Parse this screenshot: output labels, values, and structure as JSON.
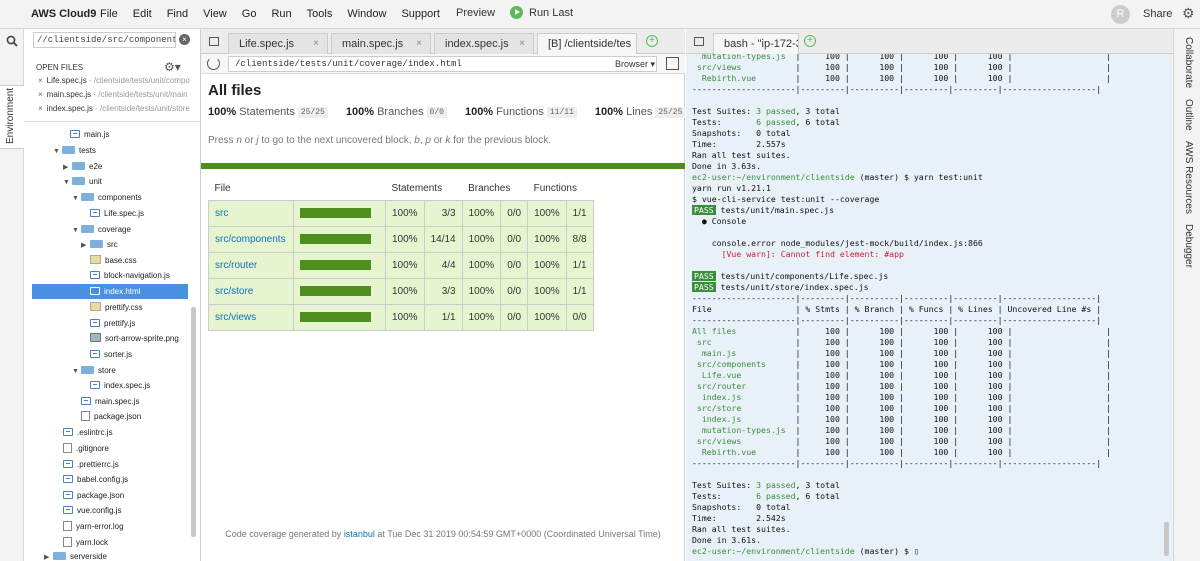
{
  "app": {
    "title": "AWS Cloud9",
    "menus": [
      "File",
      "Edit",
      "Find",
      "View",
      "Go",
      "Run",
      "Tools",
      "Window",
      "Support"
    ],
    "preview": "Preview",
    "run_last": "Run Last",
    "user_initial": "R",
    "share": "Share"
  },
  "left_rail": {
    "tab": "Environment"
  },
  "sidebar": {
    "path": "//clientside/src/components",
    "open_files_header": "OPEN FILES",
    "open_files": [
      {
        "name": "Life.spec.js",
        "path": " - /clientside/tests/unit/compo"
      },
      {
        "name": "main.spec.js",
        "path": " - /clientside/tests/unit/main"
      },
      {
        "name": "index.spec.js",
        "path": " - /clientside/tests/unit/store"
      }
    ],
    "tree": [
      {
        "label": "main.js"
      },
      {
        "label": "tests"
      },
      {
        "label": "e2e"
      },
      {
        "label": "unit"
      },
      {
        "label": "components"
      },
      {
        "label": "Life.spec.js"
      },
      {
        "label": "coverage"
      },
      {
        "label": "src"
      },
      {
        "label": "base.css"
      },
      {
        "label": "block-navigation.js"
      },
      {
        "label": "index.html"
      },
      {
        "label": "prettify.css"
      },
      {
        "label": "prettify.js"
      },
      {
        "label": "sort-arrow-sprite.png"
      },
      {
        "label": "sorter.js"
      },
      {
        "label": "store"
      },
      {
        "label": "index.spec.js"
      },
      {
        "label": "main.spec.js"
      },
      {
        "label": "package.json"
      },
      {
        "label": ".eslintrc.js"
      },
      {
        "label": ".gitignore"
      },
      {
        "label": ".prettierrc.js"
      },
      {
        "label": "babel.config.js"
      },
      {
        "label": "package.json"
      },
      {
        "label": "vue.config.js"
      },
      {
        "label": "yarn-error.log"
      },
      {
        "label": "yarn.lock"
      },
      {
        "label": "serverside"
      }
    ]
  },
  "editor_tabs": [
    "Life.spec.js",
    "main.spec.js",
    "index.spec.js",
    "[B] /clientside/tes"
  ],
  "browser": {
    "url": "/clientside/tests/unit/coverage/index.html",
    "mode": "Browser",
    "heading": "All files",
    "summary": [
      {
        "pct": "100%",
        "label": "Statements",
        "frac": "25/25"
      },
      {
        "pct": "100%",
        "label": "Branches",
        "frac": "0/0"
      },
      {
        "pct": "100%",
        "label": "Functions",
        "frac": "11/11"
      },
      {
        "pct": "100%",
        "label": "Lines",
        "frac": "25/25"
      }
    ],
    "hint_a": "Press ",
    "hint_n": "n",
    "hint_b": " or ",
    "hint_j": "j",
    "hint_c": " to go to the next uncovered block, ",
    "hint_bk": "b",
    "hint_d": ", ",
    "hint_p": "p",
    "hint_e": " or ",
    "hint_k": "k",
    "hint_f": " for the previous block.",
    "columns": [
      "File",
      "Statements",
      "Branches",
      "Functions"
    ],
    "rows": [
      {
        "file": "src",
        "stmt_pct": "100%",
        "stmt": "3/3",
        "br_pct": "100%",
        "br": "0/0",
        "fn_pct": "100%",
        "fn": "1/1",
        "bar": 1.0
      },
      {
        "file": "src/components",
        "stmt_pct": "100%",
        "stmt": "14/14",
        "br_pct": "100%",
        "br": "0/0",
        "fn_pct": "100%",
        "fn": "8/8",
        "bar": 1.0
      },
      {
        "file": "src/router",
        "stmt_pct": "100%",
        "stmt": "4/4",
        "br_pct": "100%",
        "br": "0/0",
        "fn_pct": "100%",
        "fn": "1/1",
        "bar": 1.0
      },
      {
        "file": "src/store",
        "stmt_pct": "100%",
        "stmt": "3/3",
        "br_pct": "100%",
        "br": "0/0",
        "fn_pct": "100%",
        "fn": "1/1",
        "bar": 1.0
      },
      {
        "file": "src/views",
        "stmt_pct": "100%",
        "stmt": "1/1",
        "br_pct": "100%",
        "br": "0/0",
        "fn_pct": "100%",
        "fn": "0/0",
        "bar": 1.0
      }
    ],
    "footer_a": "Code coverage generated by ",
    "footer_link": "istanbul",
    "footer_b": " at Tue Dec 31 2019 00:54:59 GMT+0000 (Coordinated Universal Time)"
  },
  "terminal": {
    "tab": "bash - \"ip-172-31",
    "lines": [
      [
        {
          "t": "  mutation-types.js  ",
          "c": "gr"
        },
        {
          "t": "|     100 |      100 |      100 |      100 |                   |"
        }
      ],
      [
        {
          "t": " src/views           ",
          "c": "gr"
        },
        {
          "t": "|     100 |      100 |      100 |      100 |                   |"
        }
      ],
      [
        {
          "t": "  Rebirth.vue        ",
          "c": "gr"
        },
        {
          "t": "|     100 |      100 |      100 |      100 |                   |"
        }
      ],
      [
        {
          "t": "---------------------|---------|----------|---------|---------|-------------------|"
        }
      ],
      [
        {
          "t": ""
        }
      ],
      [
        {
          "t": "Test Suites: "
        },
        {
          "t": "3 passed",
          "c": "gr"
        },
        {
          "t": ", 3 total"
        }
      ],
      [
        {
          "t": "Tests:       "
        },
        {
          "t": "6 passed",
          "c": "gr"
        },
        {
          "t": ", 6 total"
        }
      ],
      [
        {
          "t": "Snapshots:   0 total"
        }
      ],
      [
        {
          "t": "Time:        2.557s"
        }
      ],
      [
        {
          "t": "Ran all test suites."
        }
      ],
      [
        {
          "t": "Done in 3.63s."
        }
      ],
      [
        {
          "t": "ec2-user:~/environment/clientside",
          "c": "gr"
        },
        {
          "t": " (master) $ yarn test:unit"
        }
      ],
      [
        {
          "t": "yarn run v1.21.1"
        }
      ],
      [
        {
          "t": "$ vue-cli-service test:unit --coverage"
        }
      ],
      [
        {
          "t": "PASS",
          "c": "badge"
        },
        {
          "t": " tests/unit/main.spec.js"
        }
      ],
      [
        {
          "t": "  ● Console"
        }
      ],
      [
        {
          "t": ""
        }
      ],
      [
        {
          "t": "    console.error node_modules/jest-mock/build/index.js:866"
        }
      ],
      [
        {
          "t": "      [Vue warn]: Cannot find element: #app",
          "c": "rd"
        }
      ],
      [
        {
          "t": ""
        }
      ],
      [
        {
          "t": "PASS",
          "c": "badge"
        },
        {
          "t": " tests/unit/components/Life.spec.js"
        }
      ],
      [
        {
          "t": "PASS",
          "c": "badge"
        },
        {
          "t": " tests/unit/store/index.spec.js"
        }
      ],
      [
        {
          "t": "---------------------|---------|----------|---------|---------|-------------------|"
        }
      ],
      [
        {
          "t": "File                 | % Stmts | % Branch | % Funcs | % Lines | Uncovered Line #s |"
        }
      ],
      [
        {
          "t": "---------------------|---------|----------|---------|---------|-------------------|"
        }
      ],
      [
        {
          "t": "All files            ",
          "c": "gr"
        },
        {
          "t": "|     100 |      100 |      100 |      100 |                   |"
        }
      ],
      [
        {
          "t": " src                 ",
          "c": "gr"
        },
        {
          "t": "|     100 |      100 |      100 |      100 |                   |"
        }
      ],
      [
        {
          "t": "  main.js            ",
          "c": "gr"
        },
        {
          "t": "|     100 |      100 |      100 |      100 |                   |"
        }
      ],
      [
        {
          "t": " src/components      ",
          "c": "gr"
        },
        {
          "t": "|     100 |      100 |      100 |      100 |                   |"
        }
      ],
      [
        {
          "t": "  Life.vue           ",
          "c": "gr"
        },
        {
          "t": "|     100 |      100 |      100 |      100 |                   |"
        }
      ],
      [
        {
          "t": " src/router          ",
          "c": "gr"
        },
        {
          "t": "|     100 |      100 |      100 |      100 |                   |"
        }
      ],
      [
        {
          "t": "  index.js           ",
          "c": "gr"
        },
        {
          "t": "|     100 |      100 |      100 |      100 |                   |"
        }
      ],
      [
        {
          "t": " src/store           ",
          "c": "gr"
        },
        {
          "t": "|     100 |      100 |      100 |      100 |                   |"
        }
      ],
      [
        {
          "t": "  index.js           ",
          "c": "gr"
        },
        {
          "t": "|     100 |      100 |      100 |      100 |                   |"
        }
      ],
      [
        {
          "t": "  mutation-types.js  ",
          "c": "gr"
        },
        {
          "t": "|     100 |      100 |      100 |      100 |                   |"
        }
      ],
      [
        {
          "t": " src/views           ",
          "c": "gr"
        },
        {
          "t": "|     100 |      100 |      100 |      100 |                   |"
        }
      ],
      [
        {
          "t": "  Rebirth.vue        ",
          "c": "gr"
        },
        {
          "t": "|     100 |      100 |      100 |      100 |                   |"
        }
      ],
      [
        {
          "t": "---------------------|---------|----------|---------|---------|-------------------|"
        }
      ],
      [
        {
          "t": ""
        }
      ],
      [
        {
          "t": "Test Suites: "
        },
        {
          "t": "3 passed",
          "c": "gr"
        },
        {
          "t": ", 3 total"
        }
      ],
      [
        {
          "t": "Tests:       "
        },
        {
          "t": "6 passed",
          "c": "gr"
        },
        {
          "t": ", 6 total"
        }
      ],
      [
        {
          "t": "Snapshots:   0 total"
        }
      ],
      [
        {
          "t": "Time:        2.542s"
        }
      ],
      [
        {
          "t": "Ran all test suites."
        }
      ],
      [
        {
          "t": "Done in 3.61s."
        }
      ],
      [
        {
          "t": "ec2-user:~/environment/clientside",
          "c": "gr"
        },
        {
          "t": " (master) $ ▯"
        }
      ]
    ]
  },
  "right_rail": [
    "Collaborate",
    "Outline",
    "AWS Resources",
    "Debugger"
  ]
}
